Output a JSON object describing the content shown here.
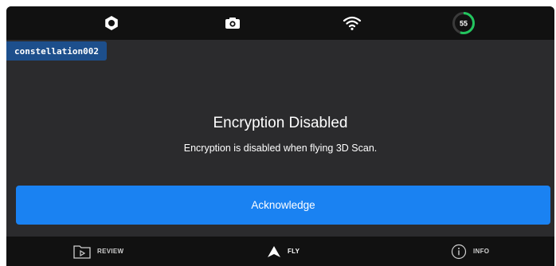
{
  "header": {
    "icons": [
      "gear-icon",
      "camera-icon",
      "wifi-icon",
      "battery-ring-icon"
    ],
    "battery_percent": "55",
    "battery_level": 0.55,
    "battery_color": "#22c55e"
  },
  "drone": {
    "name": "constellation002"
  },
  "dialog": {
    "title": "Encryption Disabled",
    "message": "Encryption is disabled when flying 3D Scan.",
    "button_label": "Acknowledge"
  },
  "nav": {
    "review_label": "REVIEW",
    "fly_label": "FLY",
    "info_label": "INFO",
    "active": "fly"
  },
  "colors": {
    "accent": "#1a82f2",
    "tag": "#1d4f8c",
    "background": "#2b2b2d",
    "bar": "#111111"
  }
}
